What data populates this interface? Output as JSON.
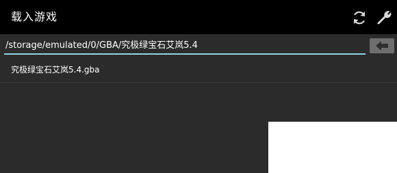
{
  "header": {
    "title": "载入游戏",
    "actions": [
      {
        "icon": "refresh-icon"
      },
      {
        "icon": "wrench-icon"
      }
    ]
  },
  "path_bar": {
    "value": "/storage/emulated/0/GBA/究极绿宝石艾岚5.4",
    "back_icon": "back-arrow-icon",
    "underline_color": "#8fd6e0"
  },
  "files": [
    {
      "name": "究极绿宝石艾岚5.4.gba"
    }
  ],
  "colors": {
    "header_bg": "#000000",
    "body_bg": "#2b2b2b",
    "button_bg": "#6e6e6e"
  }
}
